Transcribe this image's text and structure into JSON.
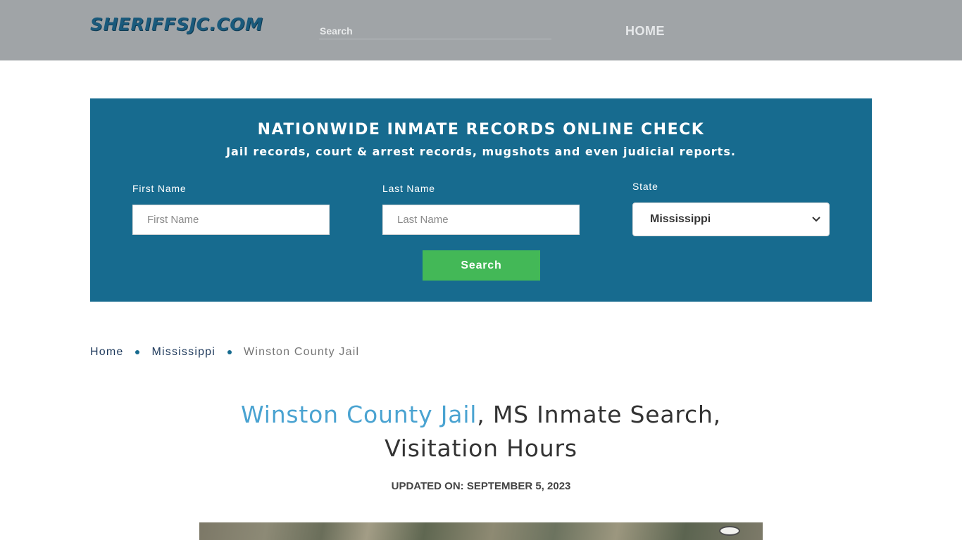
{
  "header": {
    "logo": "SHERIFFSJC.COM",
    "search_placeholder": "Search",
    "nav_home": "HOME"
  },
  "promo": {
    "title": "NATIONWIDE INMATE RECORDS ONLINE CHECK",
    "subtitle": "Jail records, court & arrest records, mugshots and even judicial reports.",
    "first_name_label": "First Name",
    "first_name_placeholder": "First Name",
    "last_name_label": "Last Name",
    "last_name_placeholder": "Last Name",
    "state_label": "State",
    "state_value": "Mississippi",
    "search_button": "Search"
  },
  "breadcrumb": {
    "items": [
      "Home",
      "Mississippi"
    ],
    "current": "Winston County Jail"
  },
  "article": {
    "title_highlight": "Winston County Jail",
    "title_rest": ", MS Inmate Search, Visitation Hours",
    "updated": "UPDATED ON: SEPTEMBER 5, 2023"
  },
  "colors": {
    "header_bg": "#a0a4a7",
    "panel_bg": "#176b8f",
    "button_green": "#43b857",
    "title_highlight": "#4aa3d1"
  },
  "icons": [
    "chevron-down-icon",
    "breadcrumb-dot-icon"
  ]
}
